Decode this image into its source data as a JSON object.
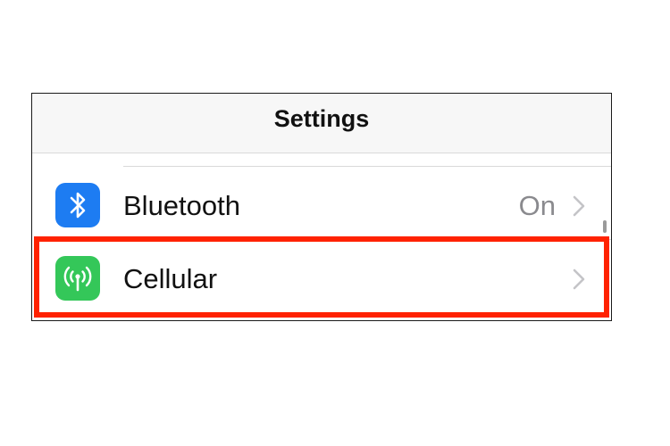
{
  "header": {
    "title": "Settings"
  },
  "rows": [
    {
      "label": "Bluetooth",
      "value": "On",
      "icon": "bluetooth-icon",
      "icon_color": "#1d7cf2"
    },
    {
      "label": "Cellular",
      "value": "",
      "icon": "antenna-icon",
      "icon_color": "#34c759"
    }
  ],
  "highlight": {
    "target": "Cellular",
    "color": "#ff2200"
  }
}
